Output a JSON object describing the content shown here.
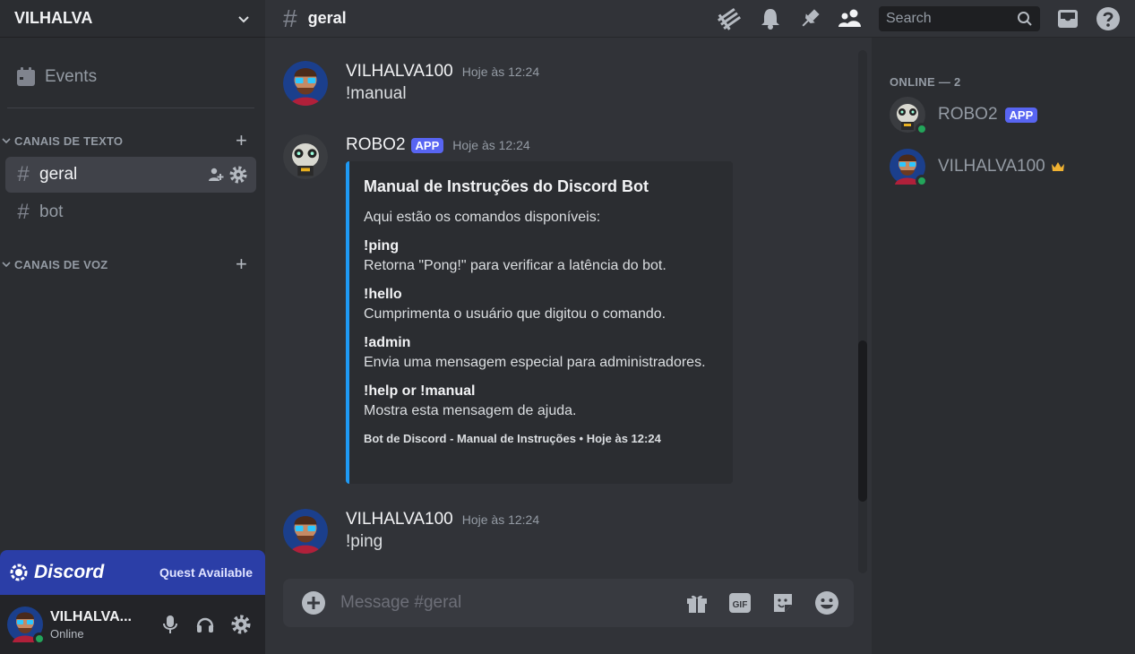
{
  "server": {
    "name": "VILHALVA"
  },
  "sidebar": {
    "events_label": "Events",
    "text_category": "CANAIS DE TEXTO",
    "voice_category": "CANAIS DE VOZ",
    "channels": [
      {
        "label": "geral",
        "active": true
      },
      {
        "label": "bot",
        "active": false
      }
    ]
  },
  "quest": {
    "brand": "Discord",
    "label": "Quest Available"
  },
  "userbar": {
    "name": "VILHALVA...",
    "status": "Online"
  },
  "topbar": {
    "channel": "geral",
    "search_placeholder": "Search"
  },
  "messages": [
    {
      "author": "VILHALVA100",
      "timestamp": "Hoje às 12:24",
      "text": "!manual"
    },
    {
      "author": "ROBO2",
      "tag": "APP",
      "timestamp": "Hoje às 12:24"
    },
    {
      "author": "VILHALVA100",
      "timestamp": "Hoje às 12:24",
      "text": "!ping"
    }
  ],
  "embed": {
    "title": "Manual de Instruções do Discord Bot",
    "description": "Aqui estão os comandos disponíveis:",
    "fields": [
      {
        "name": "!ping",
        "value": "Retorna \"Pong!\" para verificar a latência do bot."
      },
      {
        "name": "!hello",
        "value": "Cumprimenta o usuário que digitou o comando."
      },
      {
        "name": "!admin",
        "value": "Envia uma mensagem especial para administradores."
      },
      {
        "name": "!help or !manual",
        "value": "Mostra esta mensagem de ajuda."
      }
    ],
    "footer": "Bot de Discord - Manual de Instruções • Hoje às 12:24",
    "accent_color": "#1e9af5"
  },
  "composer": {
    "placeholder": "Message #geral"
  },
  "members": {
    "category": "ONLINE — 2",
    "list": [
      {
        "name": "ROBO2",
        "tag": "APP"
      },
      {
        "name": "VILHALVA100",
        "owner": true
      }
    ]
  },
  "colors": {
    "accent": "#5865f2",
    "online": "#23a55a",
    "quest_bg": "#2b3ea7"
  }
}
